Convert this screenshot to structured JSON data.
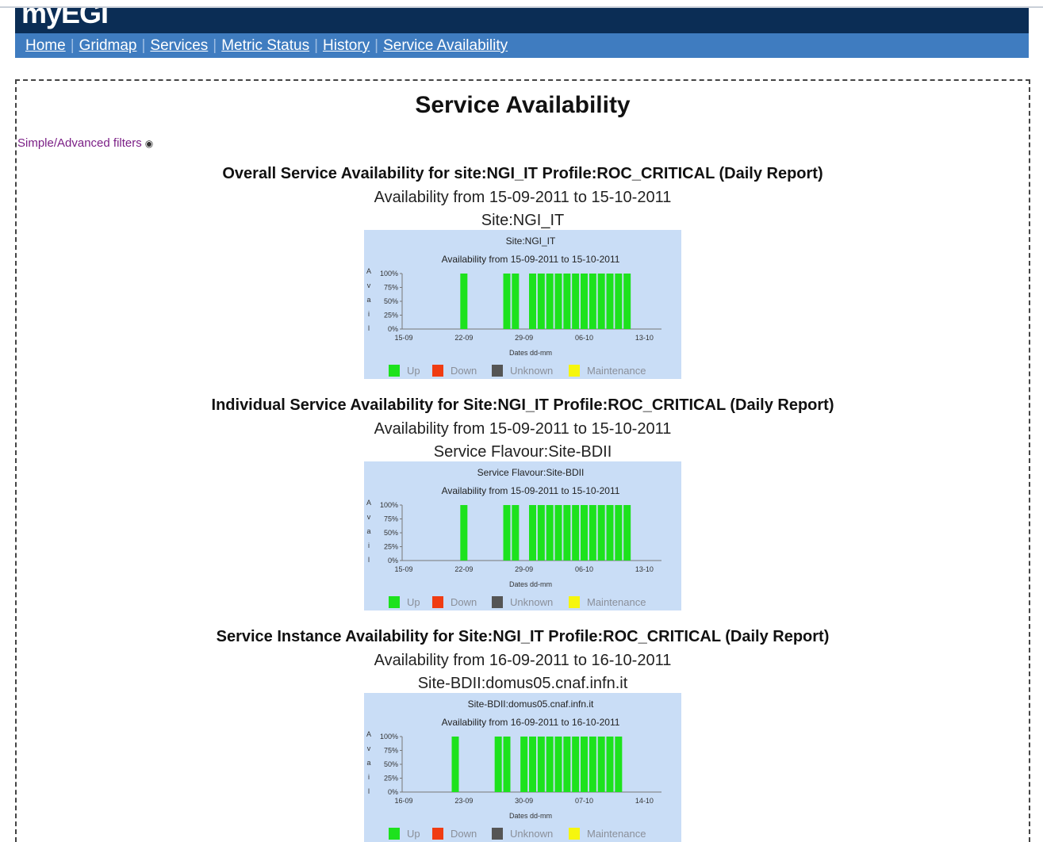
{
  "header": {
    "logo": "myEGI"
  },
  "nav": {
    "items": [
      "Home",
      "Gridmap",
      "Services",
      "Metric Status",
      "History",
      "Service Availability"
    ]
  },
  "page": {
    "title": "Service Availability",
    "filters_link": "Simple/Advanced filters"
  },
  "sections": [
    {
      "title": "Overall Service Availability for site:NGI_IT Profile:ROC_CRITICAL (Daily Report)",
      "range": "Availability from 15-09-2011 to 15-10-2011",
      "caption": "Site:NGI_IT"
    },
    {
      "title": "Individual Service Availability for Site:NGI_IT Profile:ROC_CRITICAL (Daily Report)",
      "range": "Availability from 15-09-2011 to 15-10-2011",
      "caption": "Service Flavour:Site-BDII"
    },
    {
      "title": "Service Instance Availability for Site:NGI_IT Profile:ROC_CRITICAL (Daily Report)",
      "range": "Availability from 16-09-2011 to 16-10-2011",
      "caption": "Site-BDII:domus05.cnaf.infn.it"
    }
  ],
  "colors": {
    "up": "#1de21d",
    "down": "#f03c12",
    "unknown": "#555555",
    "maintenance": "#f6f60e",
    "chart_bg": "#c9ddf6"
  },
  "chart_data": [
    {
      "type": "bar",
      "title": "Site:NGI_IT",
      "subtitle": "Availability from 15-09-2011 to 15-10-2011",
      "xlabel": "Dates dd-mm",
      "ylabel": "Avail",
      "ylim": [
        0,
        100
      ],
      "yticks": [
        "0%",
        "25%",
        "50%",
        "75%",
        "100%"
      ],
      "xticks": [
        "15-09",
        "22-09",
        "29-09",
        "06-10",
        "13-10"
      ],
      "categories": [
        "15-09",
        "16-09",
        "17-09",
        "18-09",
        "19-09",
        "20-09",
        "21-09",
        "22-09",
        "23-09",
        "24-09",
        "25-09",
        "26-09",
        "27-09",
        "28-09",
        "29-09",
        "30-09",
        "01-10",
        "02-10",
        "03-10",
        "04-10",
        "05-10",
        "06-10",
        "07-10",
        "08-10",
        "09-10",
        "10-10",
        "11-10",
        "12-10",
        "13-10",
        "14-10",
        "15-10"
      ],
      "values": [
        0,
        0,
        0,
        0,
        0,
        0,
        0,
        100,
        0,
        0,
        0,
        0,
        100,
        100,
        0,
        100,
        100,
        100,
        100,
        100,
        100,
        100,
        100,
        100,
        100,
        100,
        100,
        0,
        0,
        0,
        0
      ],
      "legend": [
        "Up",
        "Down",
        "Unknown",
        "Maintenance"
      ]
    },
    {
      "type": "bar",
      "title": "Service Flavour:Site-BDII",
      "subtitle": "Availability from 15-09-2011 to 15-10-2011",
      "xlabel": "Dates dd-mm",
      "ylabel": "Avail",
      "ylim": [
        0,
        100
      ],
      "yticks": [
        "0%",
        "25%",
        "50%",
        "75%",
        "100%"
      ],
      "xticks": [
        "15-09",
        "22-09",
        "29-09",
        "06-10",
        "13-10"
      ],
      "categories": [
        "15-09",
        "16-09",
        "17-09",
        "18-09",
        "19-09",
        "20-09",
        "21-09",
        "22-09",
        "23-09",
        "24-09",
        "25-09",
        "26-09",
        "27-09",
        "28-09",
        "29-09",
        "30-09",
        "01-10",
        "02-10",
        "03-10",
        "04-10",
        "05-10",
        "06-10",
        "07-10",
        "08-10",
        "09-10",
        "10-10",
        "11-10",
        "12-10",
        "13-10",
        "14-10",
        "15-10"
      ],
      "values": [
        0,
        0,
        0,
        0,
        0,
        0,
        0,
        100,
        0,
        0,
        0,
        0,
        100,
        100,
        0,
        100,
        100,
        100,
        100,
        100,
        100,
        100,
        100,
        100,
        100,
        100,
        100,
        0,
        0,
        0,
        0
      ],
      "legend": [
        "Up",
        "Down",
        "Unknown",
        "Maintenance"
      ]
    },
    {
      "type": "bar",
      "title": "Site-BDII:domus05.cnaf.infn.it",
      "subtitle": "Availability from 16-09-2011 to 16-10-2011",
      "xlabel": "Dates dd-mm",
      "ylabel": "Avail",
      "ylim": [
        0,
        100
      ],
      "yticks": [
        "0%",
        "25%",
        "50%",
        "75%",
        "100%"
      ],
      "xticks": [
        "16-09",
        "23-09",
        "30-09",
        "07-10",
        "14-10"
      ],
      "categories": [
        "16-09",
        "17-09",
        "18-09",
        "19-09",
        "20-09",
        "21-09",
        "22-09",
        "23-09",
        "24-09",
        "25-09",
        "26-09",
        "27-09",
        "28-09",
        "29-09",
        "30-09",
        "01-10",
        "02-10",
        "03-10",
        "04-10",
        "05-10",
        "06-10",
        "07-10",
        "08-10",
        "09-10",
        "10-10",
        "11-10",
        "12-10",
        "13-10",
        "14-10",
        "15-10",
        "16-10"
      ],
      "values": [
        0,
        0,
        0,
        0,
        0,
        0,
        100,
        0,
        0,
        0,
        0,
        100,
        100,
        0,
        100,
        100,
        100,
        100,
        100,
        100,
        100,
        100,
        100,
        100,
        100,
        100,
        0,
        0,
        0,
        0,
        0
      ],
      "legend": [
        "Up",
        "Down",
        "Unknown",
        "Maintenance"
      ]
    }
  ]
}
